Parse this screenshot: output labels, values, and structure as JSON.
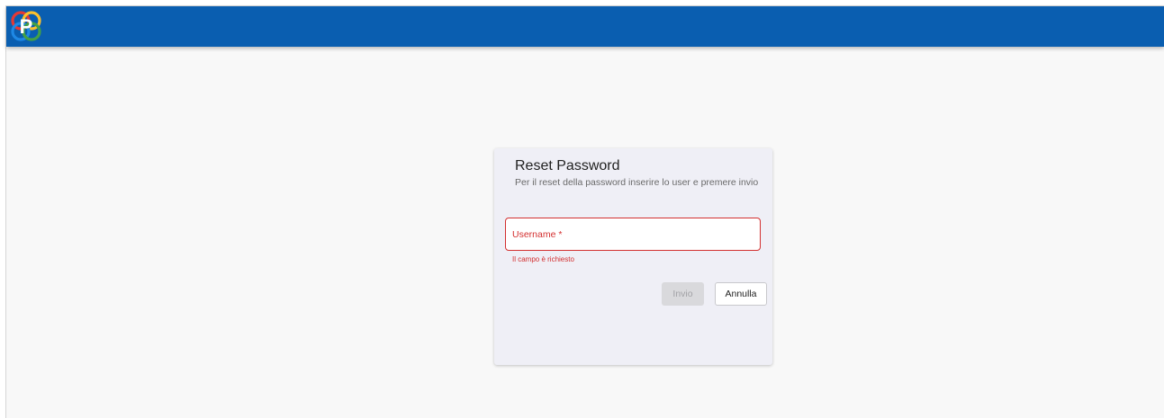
{
  "header": {
    "logo_letter": "P",
    "logo_colors": [
      "#e53935",
      "#fbc02d",
      "#1e88e5",
      "#43a047"
    ],
    "bar_color": "#0a5eb0"
  },
  "reset_form": {
    "title": "Reset Password",
    "subtitle": "Per il reset della password inserire lo user e premere invio",
    "username_label": "Username *",
    "username_value": "",
    "username_error": "Il campo è richiesto",
    "send_label": "Invio",
    "cancel_label": "Annulla",
    "error_color": "#d32f2f"
  }
}
